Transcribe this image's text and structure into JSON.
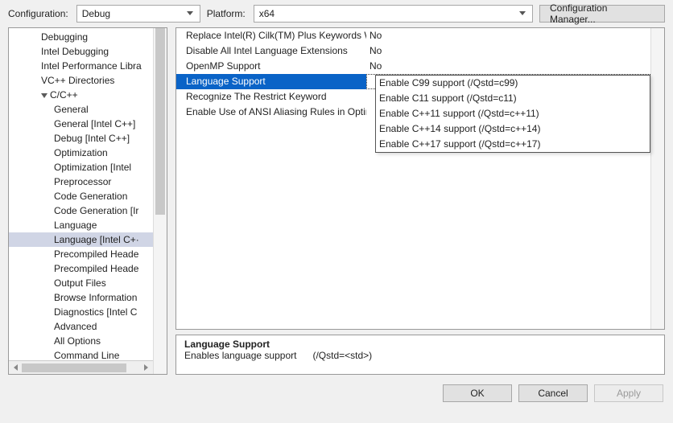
{
  "top": {
    "config_label": "Configuration:",
    "config_value": "Debug",
    "platform_label": "Platform:",
    "platform_value": "x64",
    "config_manager": "Configuration Manager..."
  },
  "tree": {
    "items": [
      {
        "label": "Debugging",
        "indent": 40
      },
      {
        "label": "Intel Debugging",
        "indent": 40
      },
      {
        "label": "Intel Performance Libra",
        "indent": 40
      },
      {
        "label": "VC++ Directories",
        "indent": 40
      },
      {
        "label": "C/C++",
        "indent": 40,
        "expand": true
      },
      {
        "label": "General",
        "indent": 56
      },
      {
        "label": "General [Intel C++]",
        "indent": 56
      },
      {
        "label": "Debug [Intel C++]",
        "indent": 56
      },
      {
        "label": "Optimization",
        "indent": 56
      },
      {
        "label": "Optimization [Intel",
        "indent": 56
      },
      {
        "label": "Preprocessor",
        "indent": 56
      },
      {
        "label": "Code Generation",
        "indent": 56
      },
      {
        "label": "Code Generation [Ir",
        "indent": 56
      },
      {
        "label": "Language",
        "indent": 56
      },
      {
        "label": "Language [Intel C+·",
        "indent": 56,
        "selected": true
      },
      {
        "label": "Precompiled Heade",
        "indent": 56
      },
      {
        "label": "Precompiled Heade",
        "indent": 56
      },
      {
        "label": "Output Files",
        "indent": 56
      },
      {
        "label": "Browse Information",
        "indent": 56
      },
      {
        "label": "Diagnostics [Intel C",
        "indent": 56
      },
      {
        "label": "Advanced",
        "indent": 56
      },
      {
        "label": "All Options",
        "indent": 56
      },
      {
        "label": "Command Line",
        "indent": 56
      }
    ]
  },
  "grid": {
    "rows": [
      {
        "name": "Replace Intel(R) Cilk(TM) Plus Keywords Wit",
        "value": "No"
      },
      {
        "name": "Disable All Intel Language Extensions",
        "value": "No"
      },
      {
        "name": "OpenMP Support",
        "value": "No"
      },
      {
        "name": "Language Support",
        "value": "",
        "selected": true
      },
      {
        "name": "Recognize The Restrict Keyword",
        "value": ""
      },
      {
        "name": "Enable Use of ANSI Aliasing Rules in Optimiz",
        "value": ""
      }
    ]
  },
  "dropdown": {
    "options": [
      "Enable C99 support (/Qstd=c99)",
      "Enable C11 support (/Qstd=c11)",
      "Enable C++11 support (/Qstd=c++11)",
      "Enable C++14 support (/Qstd=c++14)",
      "Enable C++17 support (/Qstd=c++17)"
    ]
  },
  "desc": {
    "title": "Language Support",
    "text": "Enables language support      (/Qstd=<std>)"
  },
  "buttons": {
    "ok": "OK",
    "cancel": "Cancel",
    "apply": "Apply"
  }
}
